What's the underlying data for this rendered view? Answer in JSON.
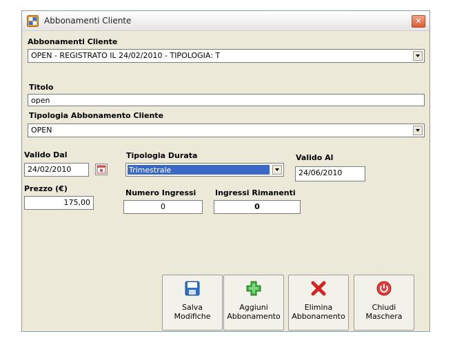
{
  "window": {
    "title": "Abbonamenti Cliente"
  },
  "fields": {
    "abbonamenti_label": "Abbonamenti Cliente",
    "abbonamenti_value": "OPEN - REGISTRATO IL 24/02/2010 - TIPOLOGIA: T",
    "titolo_label": "Titolo",
    "titolo_value": "open",
    "tipologia_label": "Tipologia Abbonamento Cliente",
    "tipologia_value": "OPEN",
    "valido_dal_label": "Valido Dal",
    "valido_dal_value": "24/02/2010",
    "tipologia_durata_label": "Tipologia Durata",
    "tipologia_durata_value": "Trimestrale",
    "valido_al_label": "Valido Al",
    "valido_al_value": "24/06/2010",
    "prezzo_label": "Prezzo (€)",
    "prezzo_value": "175,00",
    "numero_ingressi_label": "Numero Ingressi",
    "numero_ingressi_value": "0",
    "ingressi_rimanenti_label": "Ingressi Rimanenti",
    "ingressi_rimanenti_value": "0"
  },
  "toolbar": {
    "save_line1": "Salva",
    "save_line2": "Modifiche",
    "add_line1": "Aggiuni",
    "add_line2": "Abbonamento",
    "delete_line1": "Elimina",
    "delete_line2": "Abbonamento",
    "close_line1": "Chiudi",
    "close_line2": "Maschera"
  },
  "icons": {
    "app": "app-window-icon",
    "close": "close-icon",
    "calendar": "calendar-icon",
    "save": "floppy-disk-icon",
    "add": "plus-cross-icon",
    "delete": "red-x-icon",
    "power": "power-icon"
  }
}
